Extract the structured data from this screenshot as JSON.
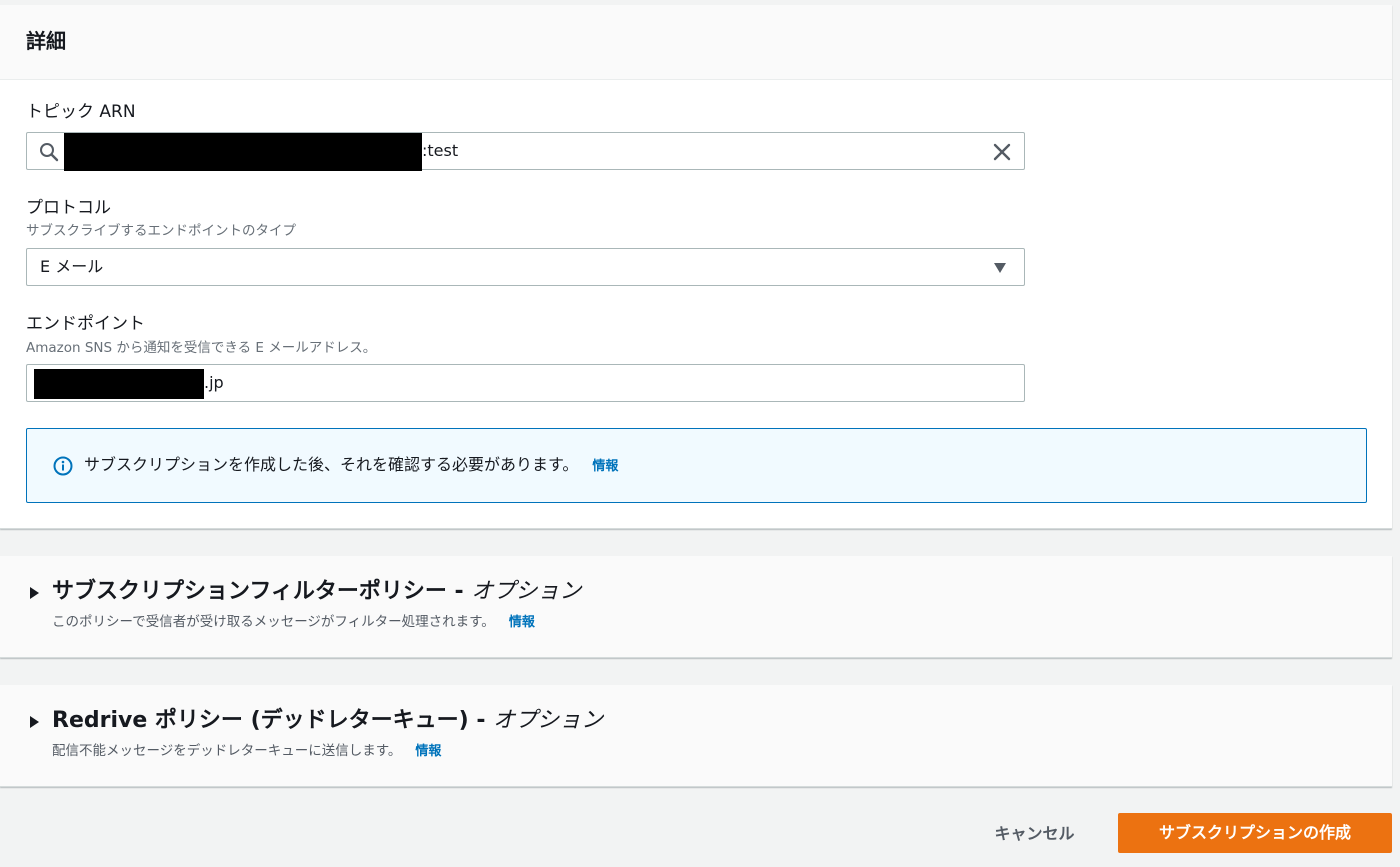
{
  "details": {
    "title": "詳細",
    "topic_arn": {
      "label": "トピック ARN",
      "value_suffix": ":test"
    },
    "protocol": {
      "label": "プロトコル",
      "description": "サブスクライブするエンドポイントのタイプ",
      "selected": "E メール"
    },
    "endpoint": {
      "label": "エンドポイント",
      "description": "Amazon SNS から通知を受信できる E メールアドレス。",
      "value_suffix": ".jp"
    },
    "info_alert": {
      "text": "サブスクリプションを作成した後、それを確認する必要があります。",
      "link": "情報"
    }
  },
  "filter_policy": {
    "title": "サブスクリプションフィルターポリシー - ",
    "optional": "オプション",
    "description": "このポリシーで受信者が受け取るメッセージがフィルター処理されます。",
    "link": "情報"
  },
  "redrive_policy": {
    "title": "Redrive ポリシー (デッドレターキュー) - ",
    "optional": "オプション",
    "description": "配信不能メッセージをデッドレターキューに送信します。",
    "link": "情報"
  },
  "footer": {
    "cancel_label": "キャンセル",
    "create_label": "サブスクリプションの作成"
  },
  "icons": {
    "search": "search-icon",
    "clear": "close-icon",
    "caret": "caret-down-icon",
    "info": "info-icon",
    "expand": "caret-right-icon"
  },
  "colors": {
    "primary_button": "#ec7211",
    "link": "#0073bb",
    "info_border": "#0073bb",
    "info_background": "#f1faff"
  }
}
